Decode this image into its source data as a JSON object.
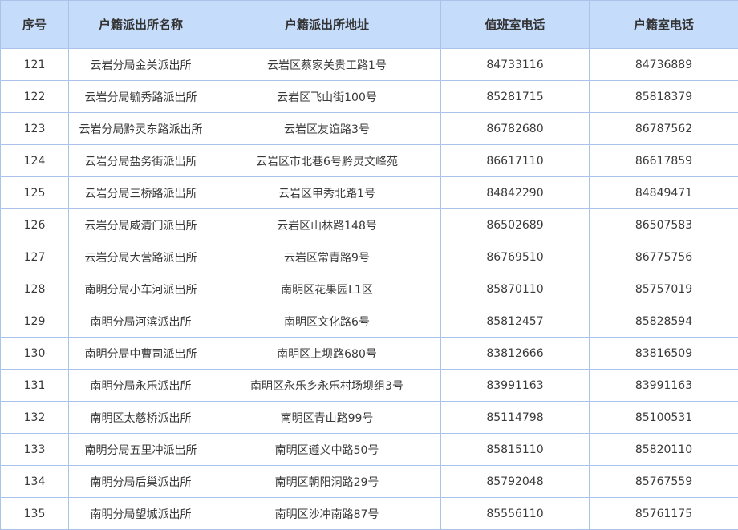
{
  "table": {
    "headers": [
      "序号",
      "户籍派出所名称",
      "户籍派出所地址",
      "值班室电话",
      "户籍室电话"
    ],
    "rows": [
      [
        "121",
        "云岩分局金关派出所",
        "云岩区蔡家关贵工路1号",
        "84733116",
        "84736889"
      ],
      [
        "122",
        "云岩分局毓秀路派出所",
        "云岩区飞山街100号",
        "85281715",
        "85818379"
      ],
      [
        "123",
        "云岩分局黔灵东路派出所",
        "云岩区友谊路3号",
        "86782680",
        "86787562"
      ],
      [
        "124",
        "云岩分局盐务街派出所",
        "云岩区市北巷6号黔灵文峰苑",
        "86617110",
        "86617859"
      ],
      [
        "125",
        "云岩分局三桥路派出所",
        "云岩区甲秀北路1号",
        "84842290",
        "84849471"
      ],
      [
        "126",
        "云岩分局威清门派出所",
        "云岩区山林路148号",
        "86502689",
        "86507583"
      ],
      [
        "127",
        "云岩分局大营路派出所",
        "云岩区常青路9号",
        "86769510",
        "86775756"
      ],
      [
        "128",
        "南明分局小车河派出所",
        "南明区花果园L1区",
        "85870110",
        "85757019"
      ],
      [
        "129",
        "南明分局河滨派出所",
        "南明区文化路6号",
        "85812457",
        "85828594"
      ],
      [
        "130",
        "南明分局中曹司派出所",
        "南明区上坝路680号",
        "83812666",
        "83816509"
      ],
      [
        "131",
        "南明分局永乐派出所",
        "南明区永乐乡永乐村场坝组3号",
        "83991163",
        "83991163"
      ],
      [
        "132",
        "南明区太慈桥派出所",
        "南明区青山路99号",
        "85114798",
        "85100531"
      ],
      [
        "133",
        "南明分局五里冲派出所",
        "南明区遵义中路50号",
        "85815110",
        "85820110"
      ],
      [
        "134",
        "南明分局后巢派出所",
        "南明区朝阳洞路29号",
        "85792048",
        "85767559"
      ],
      [
        "135",
        "南明分局望城派出所",
        "南明区沙冲南路87号",
        "85556110",
        "85761175"
      ]
    ]
  }
}
